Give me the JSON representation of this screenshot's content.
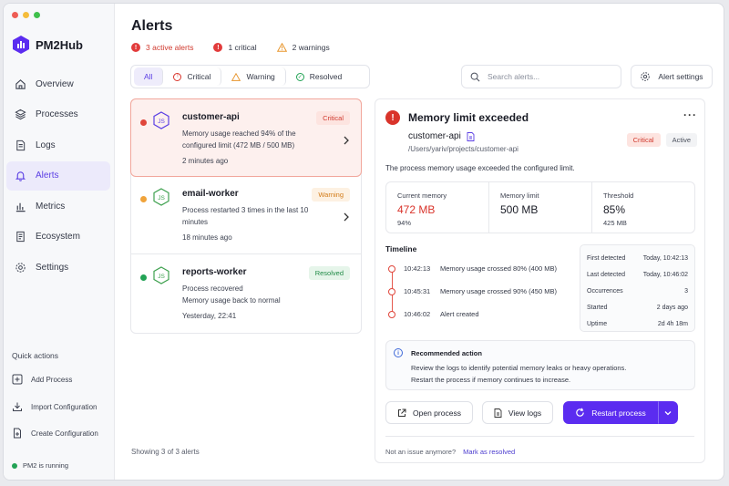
{
  "app": {
    "name": "PM2Hub"
  },
  "nav": [
    {
      "label": "Overview",
      "icon": "home-icon"
    },
    {
      "label": "Processes",
      "icon": "layers-icon"
    },
    {
      "label": "Logs",
      "icon": "file-icon"
    },
    {
      "label": "Alerts",
      "icon": "bell-icon",
      "active": true
    },
    {
      "label": "Metrics",
      "icon": "bar-chart-icon"
    },
    {
      "label": "Ecosystem",
      "icon": "document-icon"
    },
    {
      "label": "Settings",
      "icon": "gear-icon"
    }
  ],
  "quick_actions": {
    "title": "Quick actions",
    "items": [
      "Add Process",
      "Import Configuration",
      "Create Configuration"
    ]
  },
  "status": {
    "text": "PM2 is running",
    "color": "#22a355"
  },
  "page": {
    "title": "Alerts"
  },
  "summary": {
    "active": "3 active alerts",
    "critical": "1 critical",
    "warnings": "2 warnings"
  },
  "filters": [
    "All",
    "Critical",
    "Warning",
    "Resolved"
  ],
  "search": {
    "placeholder": "Search alerts..."
  },
  "alert_settings_label": "Alert settings",
  "alerts": [
    {
      "name": "customer-api",
      "desc": "Memory usage reached 94% of the configured limit (472 MB / 500 MB)",
      "time": "2 minutes ago",
      "badge": "Critical",
      "dot_color": "#e0463b",
      "badge_bg": "#fde4e0",
      "badge_fg": "#d0392e",
      "selected": true,
      "chevron": true
    },
    {
      "name": "email-worker",
      "desc": "Process restarted 3 times in the last 10 minutes",
      "time": "18 minutes ago",
      "badge": "Warning",
      "dot_color": "#f0a33a",
      "badge_bg": "#fdf1e2",
      "badge_fg": "#d27b17",
      "selected": false,
      "chevron": true
    },
    {
      "name": "reports-worker",
      "desc": "Process recovered\nMemory usage back to normal",
      "time": "Yesterday, 22:41",
      "badge": "Resolved",
      "dot_color": "#22a355",
      "badge_bg": "#e6f5ea",
      "badge_fg": "#1e8a45",
      "selected": false,
      "chevron": false
    }
  ],
  "showing": "Showing 3 of 3 alerts",
  "detail": {
    "title": "Memory limit exceeded",
    "process": "customer-api",
    "path": "/Users/yariv/projects/customer-api",
    "badge_severity": "Critical",
    "badge_state": "Active",
    "description": "The process memory usage exceeded the configured limit.",
    "metrics": [
      {
        "label": "Current memory",
        "value": "472 MB",
        "sub": "94%",
        "color": "#d9342b"
      },
      {
        "label": "Memory limit",
        "value": "500 MB",
        "sub": "",
        "color": "#1a1c26"
      },
      {
        "label": "Threshold",
        "value": "85%",
        "sub": "425 MB",
        "color": "#1a1c26"
      }
    ],
    "timeline_title": "Timeline",
    "timeline": [
      {
        "time": "10:42:13",
        "text": "Memory usage crossed 80% (400 MB)"
      },
      {
        "time": "10:45:31",
        "text": "Memory usage crossed 90% (450 MB)"
      },
      {
        "time": "10:46:02",
        "text": "Alert created"
      }
    ],
    "info": [
      {
        "key": "First detected",
        "value": "Today, 10:42:13"
      },
      {
        "key": "Last detected",
        "value": "Today, 10:46:02"
      },
      {
        "key": "Occurrences",
        "value": "3"
      },
      {
        "key": "Started",
        "value": "2 days ago"
      },
      {
        "key": "Uptime",
        "value": "2d 4h 18m"
      }
    ],
    "recommended": {
      "title": "Recommended action",
      "line1": "Review the logs to identify potential memory leaks or heavy operations.",
      "line2": "Restart the process if memory continues to increase."
    },
    "buttons": {
      "open": "Open process",
      "logs": "View logs",
      "restart": "Restart process"
    },
    "footer": {
      "question": "Not an issue anymore?",
      "link": "Mark as resolved"
    }
  },
  "colors": {
    "accent": "#5b2cf0",
    "critical": "#d9342b",
    "warning": "#f0a33a",
    "success": "#22a355"
  }
}
